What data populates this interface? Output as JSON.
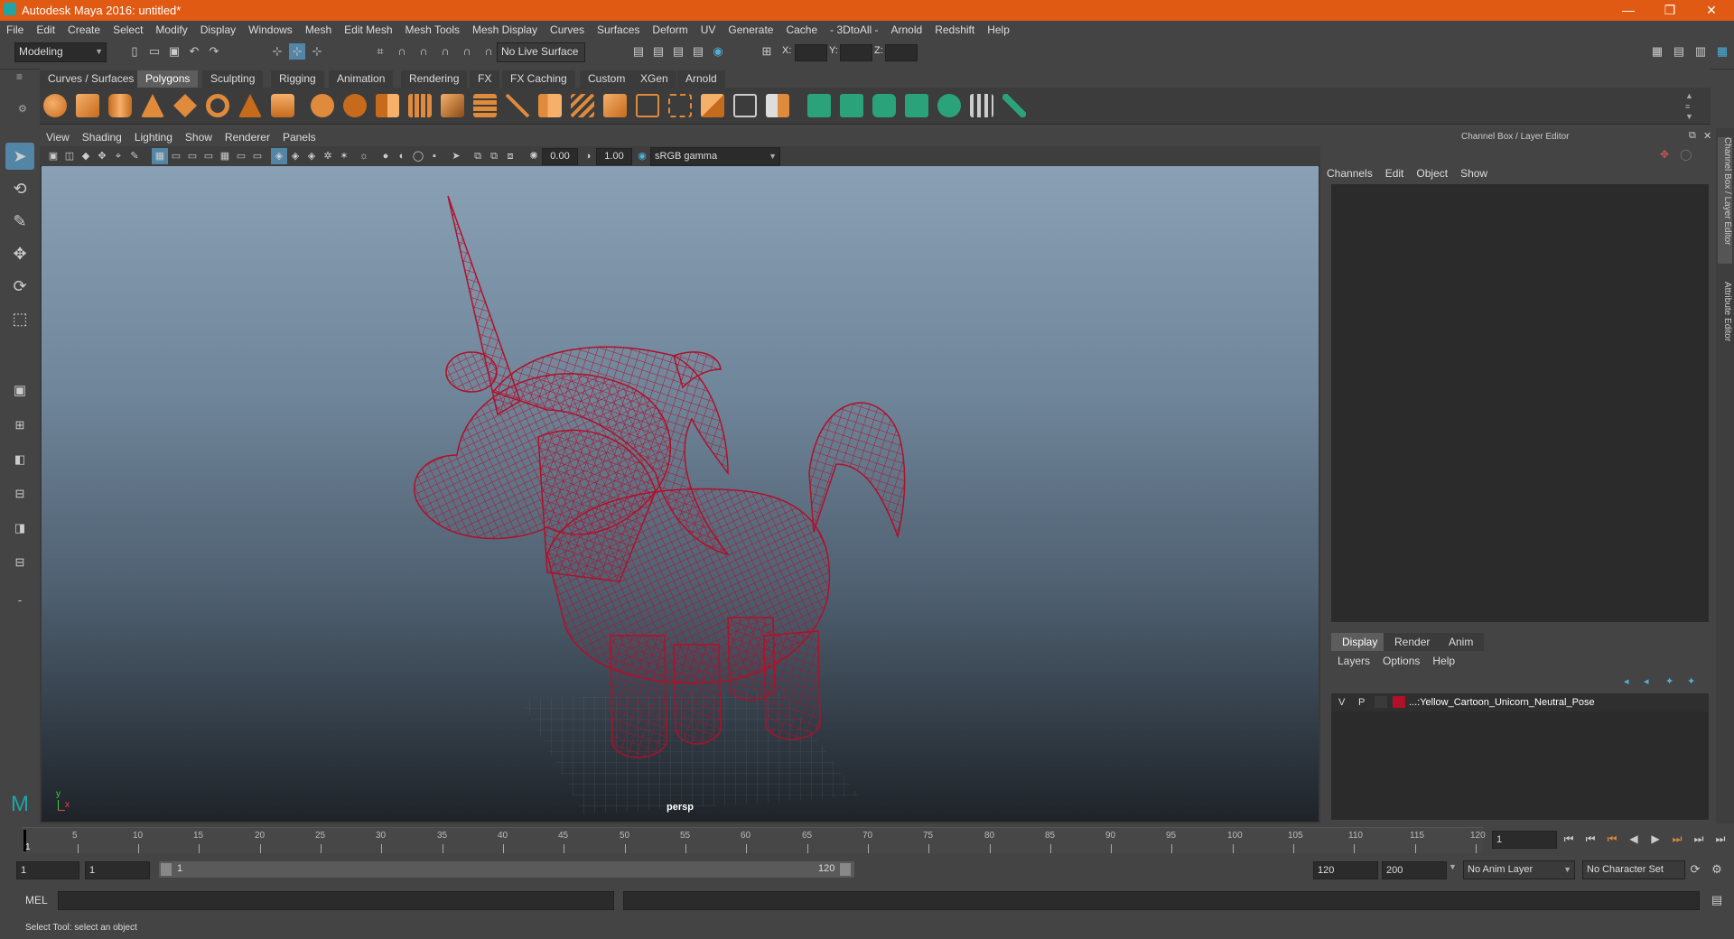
{
  "title": "Autodesk Maya 2016: untitled*",
  "window_controls": {
    "minimize": "—",
    "restore": "❐",
    "close": "✕"
  },
  "menus": [
    "File",
    "Edit",
    "Create",
    "Select",
    "Modify",
    "Display",
    "Windows",
    "Mesh",
    "Edit Mesh",
    "Mesh Tools",
    "Mesh Display",
    "Curves",
    "Surfaces",
    "Deform",
    "UV",
    "Generate",
    "Cache",
    "- 3DtoAll -",
    "Arnold",
    "Redshift",
    "Help"
  ],
  "statusline": {
    "menuset": "Modeling",
    "live_surface": "No Live Surface",
    "x_label": "X:",
    "y_label": "Y:",
    "z_label": "Z:"
  },
  "shelf_tabs": [
    "Curves / Surfaces",
    "Polygons",
    "Sculpting",
    "Rigging",
    "Animation",
    "Rendering",
    "FX",
    "FX Caching",
    "Custom",
    "XGen",
    "Arnold"
  ],
  "shelf_active": "Polygons",
  "viewport": {
    "menus": [
      "View",
      "Shading",
      "Lighting",
      "Show",
      "Renderer",
      "Panels"
    ],
    "near_value": "0.00",
    "far_value": "1.00",
    "colorspace": "sRGB gamma",
    "camera_label": "persp",
    "axis_y": "y",
    "axis_x": "x"
  },
  "channel_box": {
    "header": "Channel Box / Layer Editor",
    "menus": [
      "Channels",
      "Edit",
      "Object",
      "Show"
    ]
  },
  "layer_editor": {
    "tabs": [
      "Display",
      "Render",
      "Anim"
    ],
    "active_tab": "Display",
    "menus": [
      "Layers",
      "Options",
      "Help"
    ],
    "layer": {
      "v": "V",
      "p": "P",
      "name": "...:Yellow_Cartoon_Unicorn_Neutral_Pose",
      "color": "#b0102a"
    }
  },
  "side_tabs": [
    "Channel Box / Layer Editor",
    "Attribute Editor"
  ],
  "timeline": {
    "ticks": [
      "5",
      "10",
      "15",
      "20",
      "25",
      "30",
      "35",
      "40",
      "45",
      "50",
      "55",
      "60",
      "65",
      "70",
      "75",
      "80",
      "85",
      "90",
      "95",
      "100",
      "105",
      "110",
      "115",
      "120"
    ],
    "start_marker": "1",
    "current_frame": "1"
  },
  "range": {
    "start": "1",
    "inner_start": "1",
    "slider_start": "1",
    "slider_end": "120",
    "end": "120",
    "anim_end": "200",
    "anim_layer": "No Anim Layer",
    "character_set": "No Character Set"
  },
  "command_line": {
    "label": "MEL"
  },
  "help_line": "Select Tool: select an object",
  "colors": {
    "titlebar": "#e05a14",
    "wireframe": "#b0102a",
    "panel": "#444444",
    "field": "#2b2b2b"
  }
}
